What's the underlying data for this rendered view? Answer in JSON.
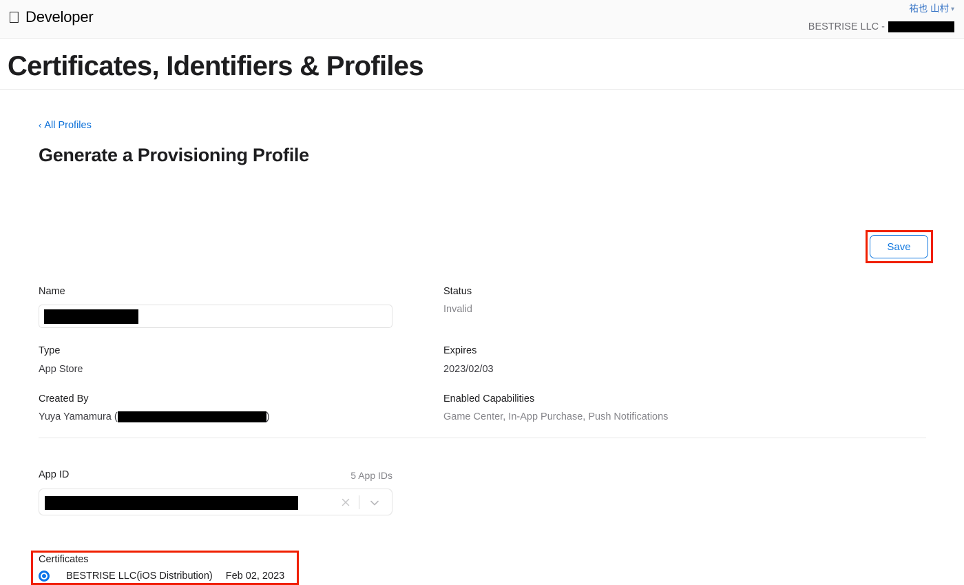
{
  "header": {
    "apple_logo_glyph": "",
    "brand_name": "Developer",
    "account_user": "祐也 山村",
    "account_chevron": "⌄",
    "team_prefix": "BESTRISE LLC -",
    "team_value_redacted": true
  },
  "page": {
    "title": "Certificates, Identifiers & Profiles"
  },
  "breadcrumb": {
    "chevron": "‹",
    "label": "All Profiles"
  },
  "section": {
    "heading": "Generate a Provisioning Profile",
    "save_label": "Save"
  },
  "fields": {
    "name_label": "Name",
    "name_value_redacted": true,
    "type_label": "Type",
    "type_value": "App Store",
    "created_by_label": "Created By",
    "created_by_prefix": "Yuya Yamamura (",
    "created_by_suffix": ")",
    "status_label": "Status",
    "status_value": "Invalid",
    "expires_label": "Expires",
    "expires_value": "2023/02/03",
    "capabilities_label": "Enabled Capabilities",
    "capabilities_value": "Game Center, In-App Purchase, Push Notifications"
  },
  "app_id": {
    "label": "App ID",
    "count_label": "5 App IDs",
    "selected_value_redacted": true,
    "clear_icon": "close-icon",
    "chevron_icon": "chevron-down-icon"
  },
  "certificates": {
    "label": "Certificates",
    "items": [
      {
        "selected": true,
        "name": "BESTRISE LLC(iOS Distribution)",
        "date": "Feb 02, 2023"
      }
    ]
  },
  "colors": {
    "link_blue": "#0a6fd8",
    "button_blue": "#1379e0",
    "annotation_red": "#f01f00",
    "radio_blue": "#0a72e8",
    "muted_gray": "#86868b",
    "header_bg": "#fafafa"
  }
}
